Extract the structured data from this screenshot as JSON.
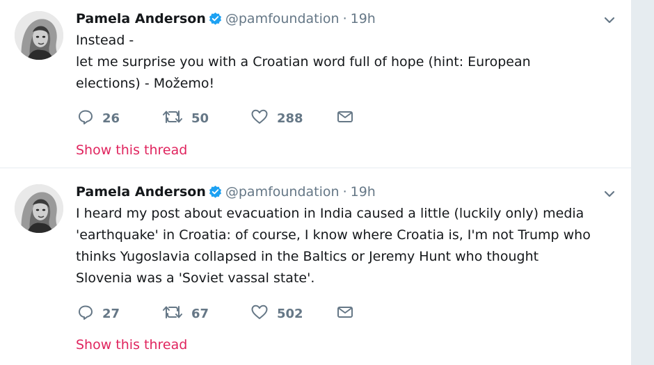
{
  "tweets": [
    {
      "name": "Pamela Anderson",
      "handle": "@pamfoundation",
      "separator": "·",
      "time": "19h",
      "lines": [
        "Instead -",
        "let me surprise you with a Croatian word full of hope (hint: European",
        "elections) - Možemo!"
      ],
      "replies": "26",
      "retweets": "50",
      "likes": "288",
      "thread_label": "Show this thread"
    },
    {
      "name": "Pamela Anderson",
      "handle": "@pamfoundation",
      "separator": "·",
      "time": "19h",
      "lines": [
        "I heard my post about evacuation in India caused a little (luckily only) media",
        "'earthquake' in Croatia: of course, I know where Croatia is, I'm not Trump who",
        "thinks Yugoslavia collapsed in the Baltics or Jeremy Hunt who thought",
        "Slovenia was a 'Soviet vassal state'."
      ],
      "replies": "27",
      "retweets": "67",
      "likes": "502",
      "thread_label": "Show this thread"
    }
  ],
  "icons": {
    "reply": "reply-icon",
    "retweet": "retweet-icon",
    "like": "heart-icon",
    "dm": "envelope-icon",
    "verified": "verified-badge-icon",
    "caret": "chevron-down-icon"
  },
  "colors": {
    "link": "#e0245e",
    "muted": "#657786",
    "verified": "#1da1f2",
    "text": "#14171a"
  }
}
